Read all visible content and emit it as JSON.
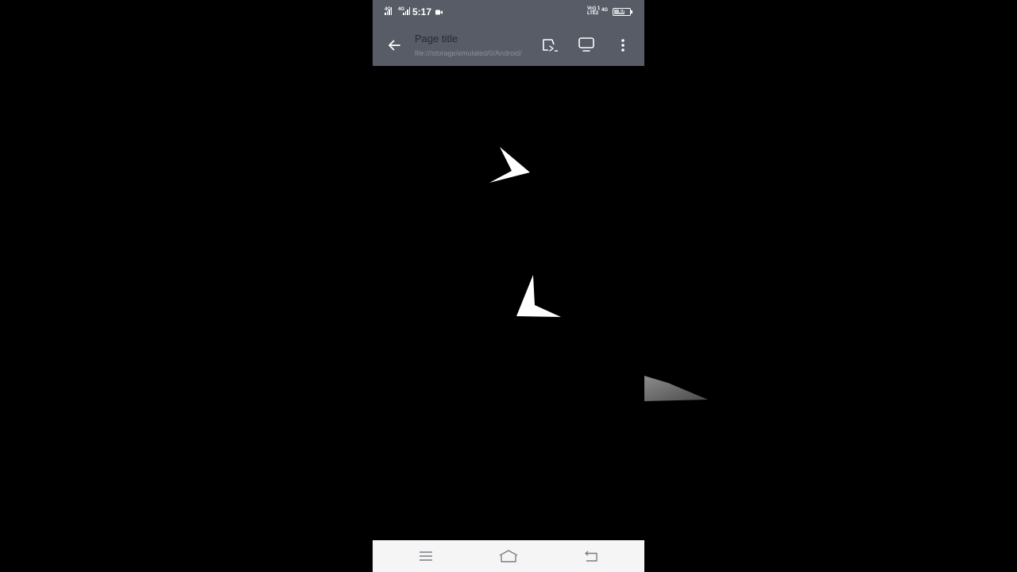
{
  "status_bar": {
    "net1": "4G",
    "net2": "4G",
    "time": "5:17",
    "volte_line1": "Vo)) 1",
    "volte_line2": "LTE2",
    "lte": "4G",
    "battery_percent": "67",
    "battery_level": 0.67,
    "icons": [
      "signal-icon",
      "signal-icon",
      "video-record-icon",
      "volte-icon",
      "battery-icon"
    ]
  },
  "toolbar": {
    "title": "Page title",
    "url": "file:///storage/emulated/0/Android/",
    "icons": [
      "back-arrow-icon",
      "share-screen-icon",
      "monitor-icon",
      "more-vert-icon"
    ]
  },
  "nav_bar": {
    "icons": [
      "menu-icon",
      "home-icon",
      "back-icon"
    ]
  },
  "colors": {
    "toolbar_bg": "#575c66",
    "content_bg": "#000000",
    "nav_bg": "#f5f5f5",
    "shape": "#ffffff"
  }
}
